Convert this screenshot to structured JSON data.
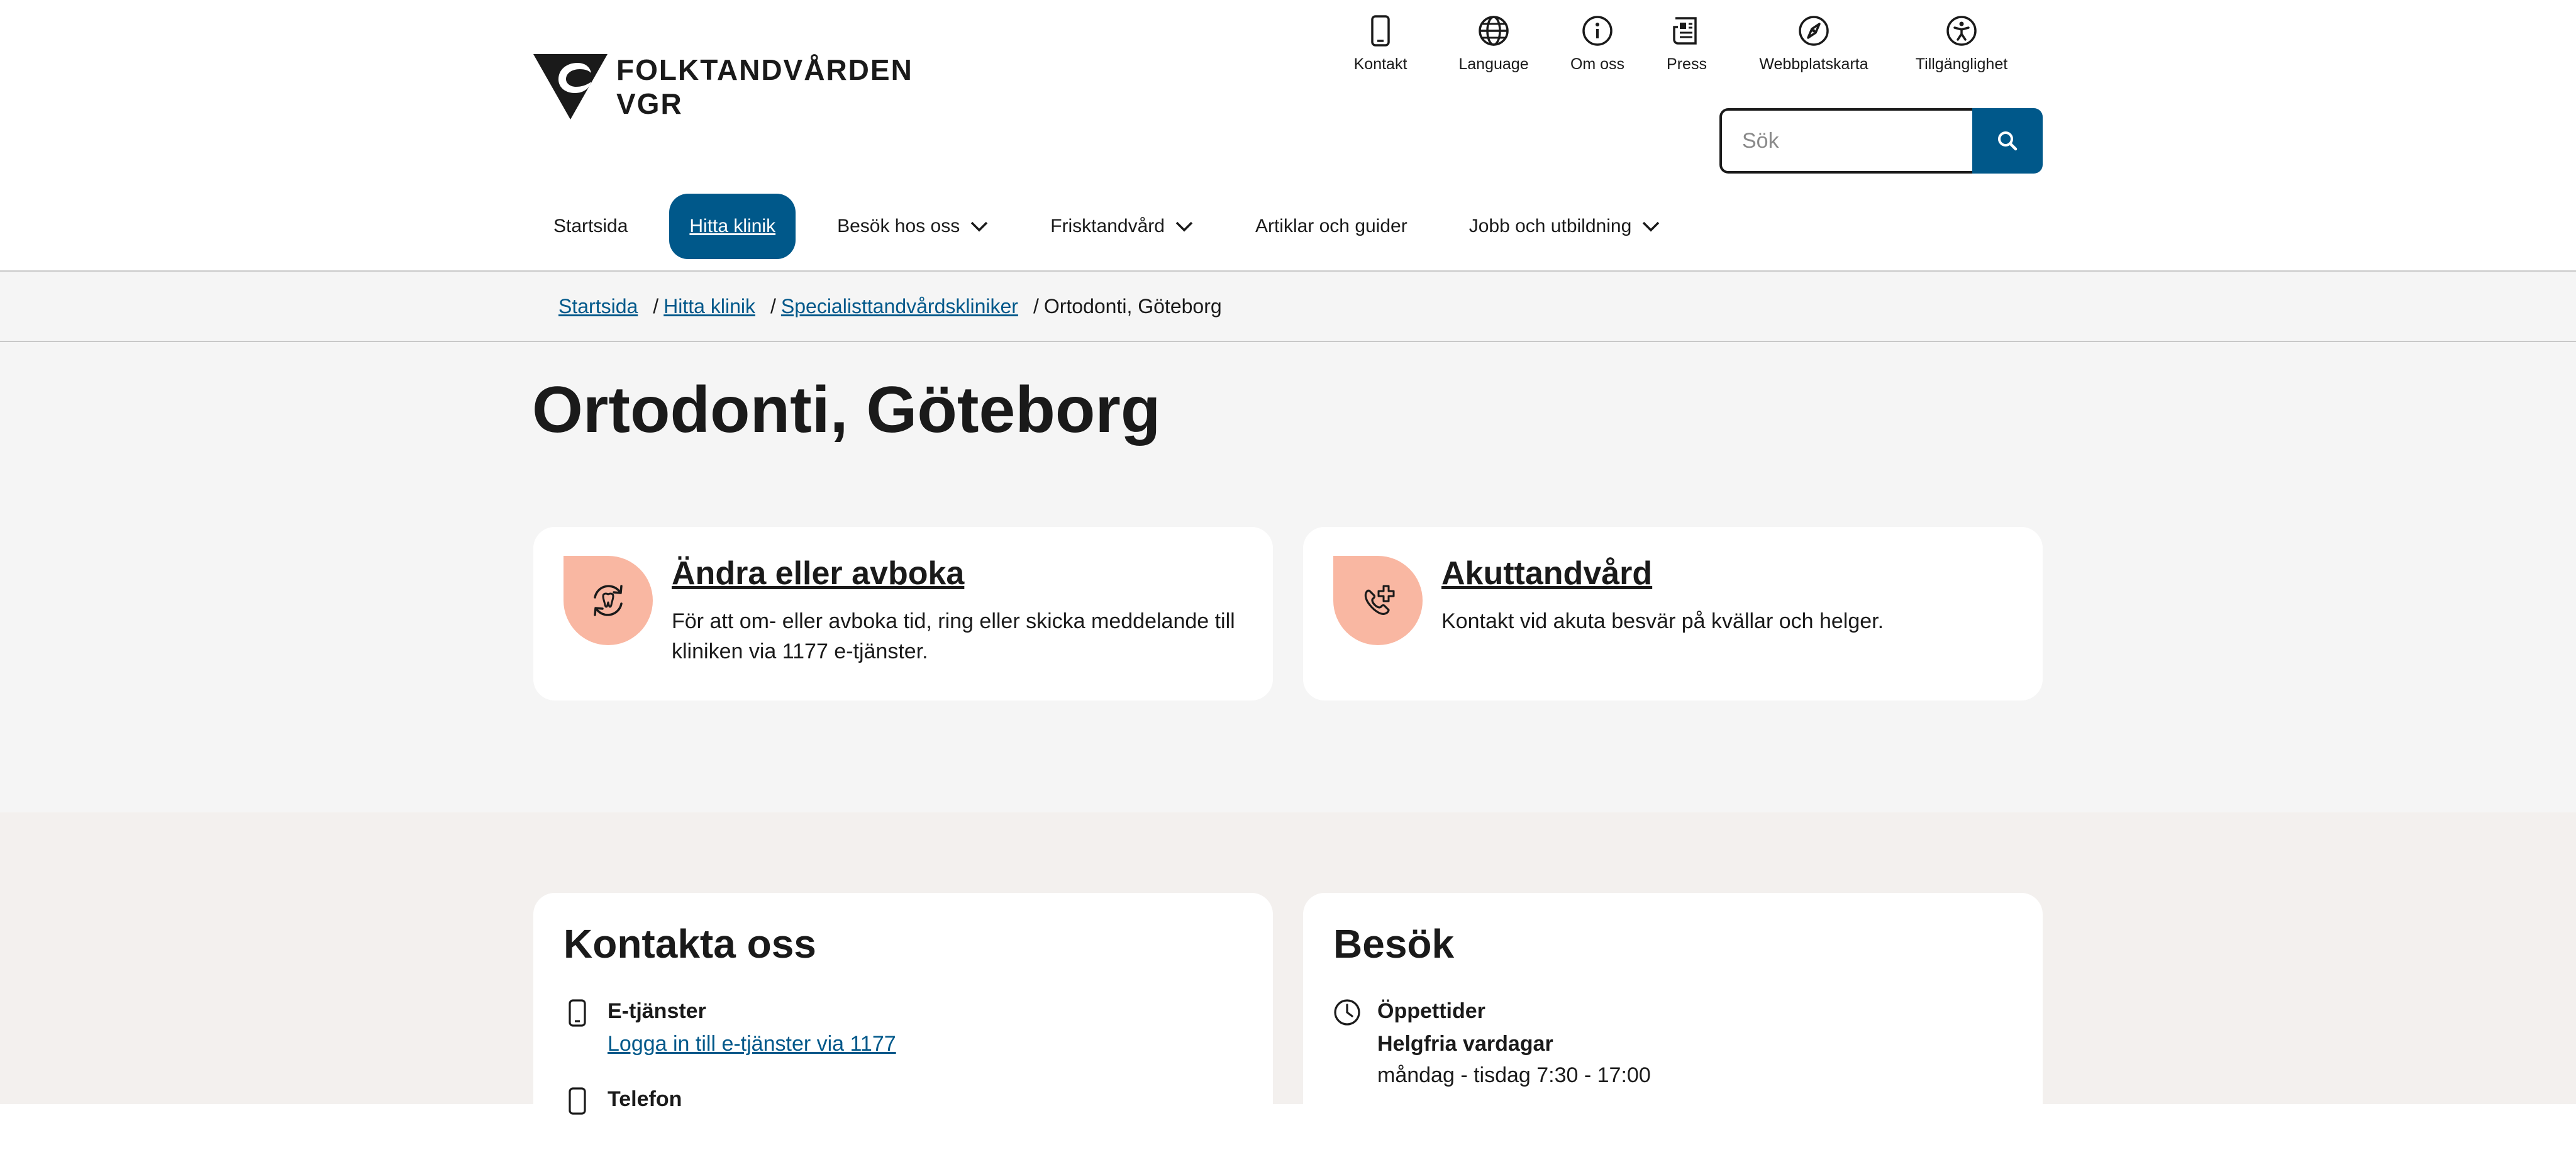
{
  "brand": {
    "name_line1": "FOLKTANDVÅRDEN",
    "name_line2": "VGR"
  },
  "utility_nav": [
    {
      "label": "Kontakt",
      "icon": "phone-icon"
    },
    {
      "label": "Language",
      "icon": "globe-icon"
    },
    {
      "label": "Om oss",
      "icon": "info-icon"
    },
    {
      "label": "Press",
      "icon": "newspaper-icon"
    },
    {
      "label": "Webbplatskarta",
      "icon": "compass-icon"
    },
    {
      "label": "Tillgänglighet",
      "icon": "accessibility-icon"
    }
  ],
  "search": {
    "placeholder": "Sök",
    "button_icon": "search-icon"
  },
  "main_nav": [
    {
      "label": "Startsida",
      "has_dropdown": false
    },
    {
      "label": "Hitta klinik",
      "active": true,
      "has_dropdown": false
    },
    {
      "label": "Besök hos oss",
      "has_dropdown": true
    },
    {
      "label": "Frisktandvård",
      "has_dropdown": true
    },
    {
      "label": "Artiklar och guider",
      "has_dropdown": false
    },
    {
      "label": "Jobb och utbildning",
      "has_dropdown": true
    }
  ],
  "breadcrumb": {
    "items": [
      {
        "label": "Startsida"
      },
      {
        "label": "Hitta klinik"
      },
      {
        "label": "Specialisttandvårdskliniker"
      }
    ],
    "separator": "/",
    "current": "Ortodonti, Göteborg"
  },
  "page": {
    "title": "Ortodonti, Göteborg"
  },
  "cards": [
    {
      "title": "Ändra eller avboka",
      "text": "För att om- eller avboka tid, ring eller skicka meddelande till kliniken via 1177 e-tjänster.",
      "icon": "rebook-tooth-icon"
    },
    {
      "title": "Akuttandvård",
      "text": "Kontakt vid akuta besvär på kvällar och helger.",
      "icon": "emergency-phone-icon"
    }
  ],
  "contact": {
    "title": "Kontakta oss",
    "eservices_label": "E-tjänster",
    "eservices_link": "Logga in till e-tjänster via 1177",
    "phone_label": "Telefon"
  },
  "visit": {
    "title": "Besök",
    "hours_label": "Öppettider",
    "weekdays_label": "Helgfria vardagar",
    "hours_text": "måndag - tisdag 7:30 - 17:00"
  },
  "colors": {
    "primary": "#00588a",
    "accent_peach": "#f9b7a2",
    "hero_bg": "#f5f5f5",
    "lower_bg": "#f3f0ee",
    "text": "#1a1a1a"
  }
}
